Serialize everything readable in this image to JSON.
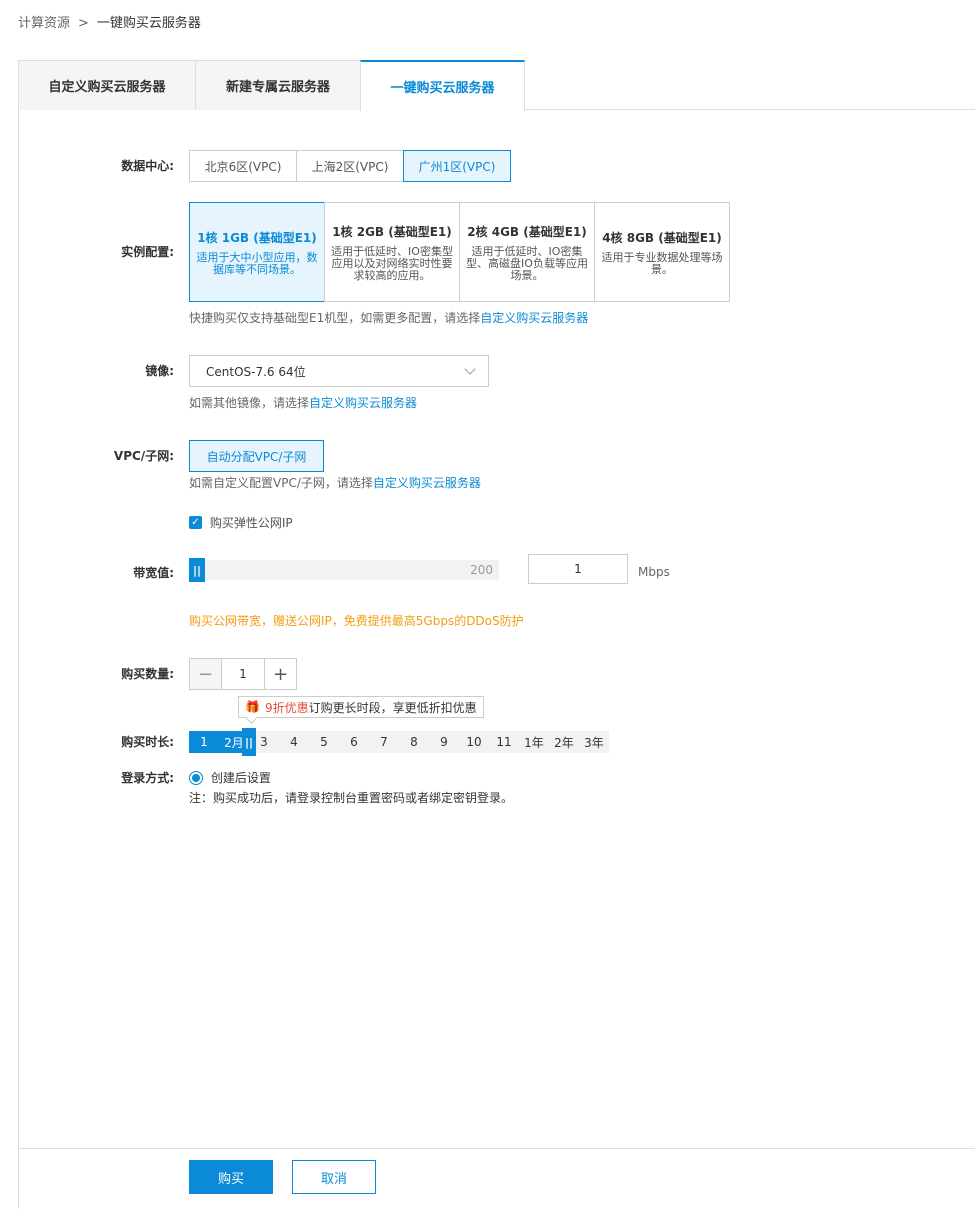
{
  "breadcrumb": {
    "root": "计算资源",
    "sep": ">",
    "current": "一键购买云服务器"
  },
  "tabs": [
    {
      "label": "自定义购买云服务器"
    },
    {
      "label": "新建专属云服务器"
    },
    {
      "label": "一键购买云服务器",
      "active": true
    }
  ],
  "datacenter": {
    "label": "数据中心:",
    "options": [
      "北京6区(VPC)",
      "上海2区(VPC)",
      "广州1区(VPC)"
    ],
    "selected": "广州1区(VPC)"
  },
  "instance": {
    "label": "实例配置:",
    "cards": [
      {
        "title": "1核 1GB (基础型E1)",
        "desc": "适用于大中小型应用，数据库等不同场景。",
        "active": true
      },
      {
        "title": "1核 2GB (基础型E1)",
        "desc": "适用于低延时、IO密集型应用以及对网络实时性要求较高的应用。"
      },
      {
        "title": "2核 4GB (基础型E1)",
        "desc": "适用于低延时、IO密集型、高磁盘IO负载等应用场景。"
      },
      {
        "title": "4核 8GB (基础型E1)",
        "desc": "适用于专业数据处理等场景。"
      }
    ],
    "hint_prefix": "快捷购买仅支持基础型E1机型，如需更多配置，请选择",
    "hint_link": "自定义购买云服务器"
  },
  "image": {
    "label": "镜像:",
    "value": "CentOS-7.6 64位",
    "hint_prefix": "如需其他镜像，请选择",
    "hint_link": "自定义购买云服务器"
  },
  "vpc": {
    "label": "VPC/子网:",
    "button": "自动分配VPC/子网",
    "hint_prefix": "如需自定义配置VPC/子网，请选择",
    "hint_link": "自定义购买云服务器"
  },
  "eip": {
    "label": "购买弹性公网IP",
    "checked": true
  },
  "bandwidth": {
    "label": "带宽值:",
    "max": "200",
    "value": "1",
    "unit": "Mbps",
    "promo": "购买公网带宽，赠送公网IP，免费提供最高5Gbps的DDoS防护",
    "promo_color": "#f39c12"
  },
  "quantity": {
    "label": "购买数量:",
    "value": "1",
    "minus": "−",
    "plus": "+"
  },
  "duration": {
    "label": "购买时长:",
    "tooltip_red": "9折优惠",
    "tooltip_rest": "订购更长时段，享更低折扣优惠",
    "items": [
      "1",
      "2月",
      "3",
      "4",
      "5",
      "6",
      "7",
      "8",
      "9",
      "10",
      "11",
      "1年",
      "2年",
      "3年"
    ],
    "selected": "1"
  },
  "login": {
    "label": "登录方式:",
    "option": "创建后设置",
    "note": "注：购买成功后，请登录控制台重置密码或者绑定密钥登录。"
  },
  "footer": {
    "buy": "购买",
    "cancel": "取消"
  },
  "colors": {
    "accent": "#0b8ad8",
    "warning": "#f39c12",
    "discount": "#e84c3d"
  }
}
